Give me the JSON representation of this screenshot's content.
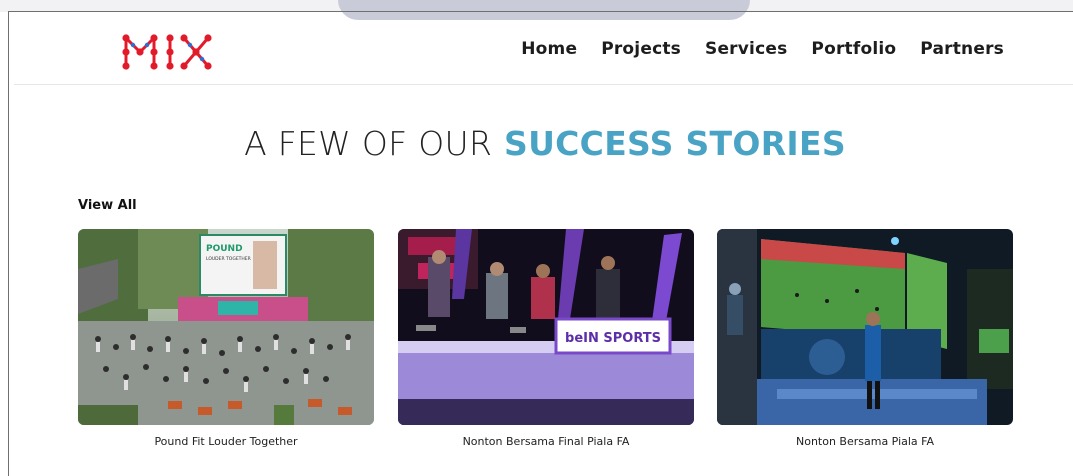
{
  "header": {
    "logo_text": "MIX",
    "nav": [
      "Home",
      "Projects",
      "Services",
      "Portfolio",
      "Partners"
    ]
  },
  "section": {
    "title_light": "A FEW OF OUR",
    "title_accent": "SUCCESS STORIES",
    "view_all": "View All"
  },
  "stories": [
    {
      "caption": "Pound Fit Louder Together",
      "screen_text_1": "POUND",
      "screen_text_2": "LOUDER TOGETHER"
    },
    {
      "caption": "Nonton Bersama Final Piala FA",
      "sign_text": "beIN SPORTS"
    },
    {
      "caption": "Nonton Bersama Piala FA"
    }
  ],
  "colors": {
    "accent": "#49a3c5",
    "logo_red": "#e21b2b"
  }
}
